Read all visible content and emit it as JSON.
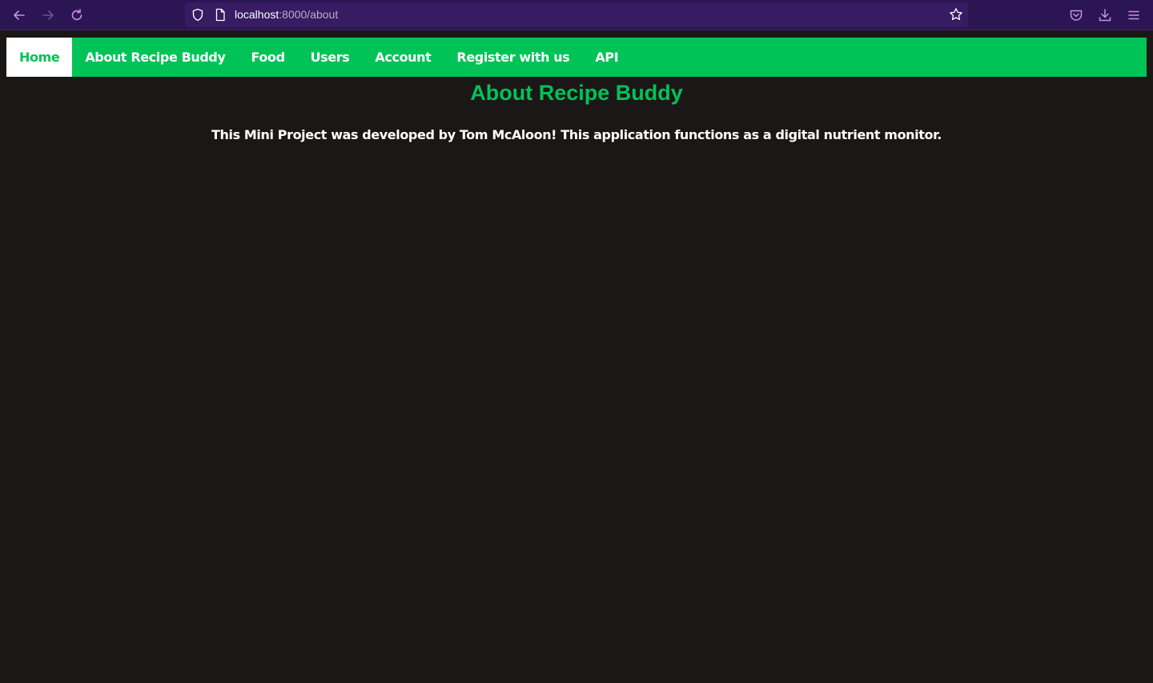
{
  "browser": {
    "url_host": "localhost",
    "url_path": ":8000/about",
    "icons": [
      "back-arrow-icon",
      "forward-arrow-icon",
      "reload-icon",
      "shield-icon",
      "page-icon",
      "bookmark-star-icon",
      "pocket-icon",
      "download-icon",
      "menu-icon"
    ]
  },
  "nav": {
    "items": [
      {
        "label": "Home",
        "active": true
      },
      {
        "label": "About Recipe Buddy",
        "active": false
      },
      {
        "label": "Food",
        "active": false
      },
      {
        "label": "Users",
        "active": false
      },
      {
        "label": "Account",
        "active": false
      },
      {
        "label": "Register with us",
        "active": false
      },
      {
        "label": "API",
        "active": false
      }
    ]
  },
  "main": {
    "title": "About Recipe Buddy",
    "description": "This Mini Project was developed by Tom McAloon! This application functions as a digital nutrient monitor."
  },
  "colors": {
    "accent": "#00c358",
    "page_background": "#1b1717",
    "browser_chrome": "#2b1552",
    "text": "#ffffff"
  }
}
